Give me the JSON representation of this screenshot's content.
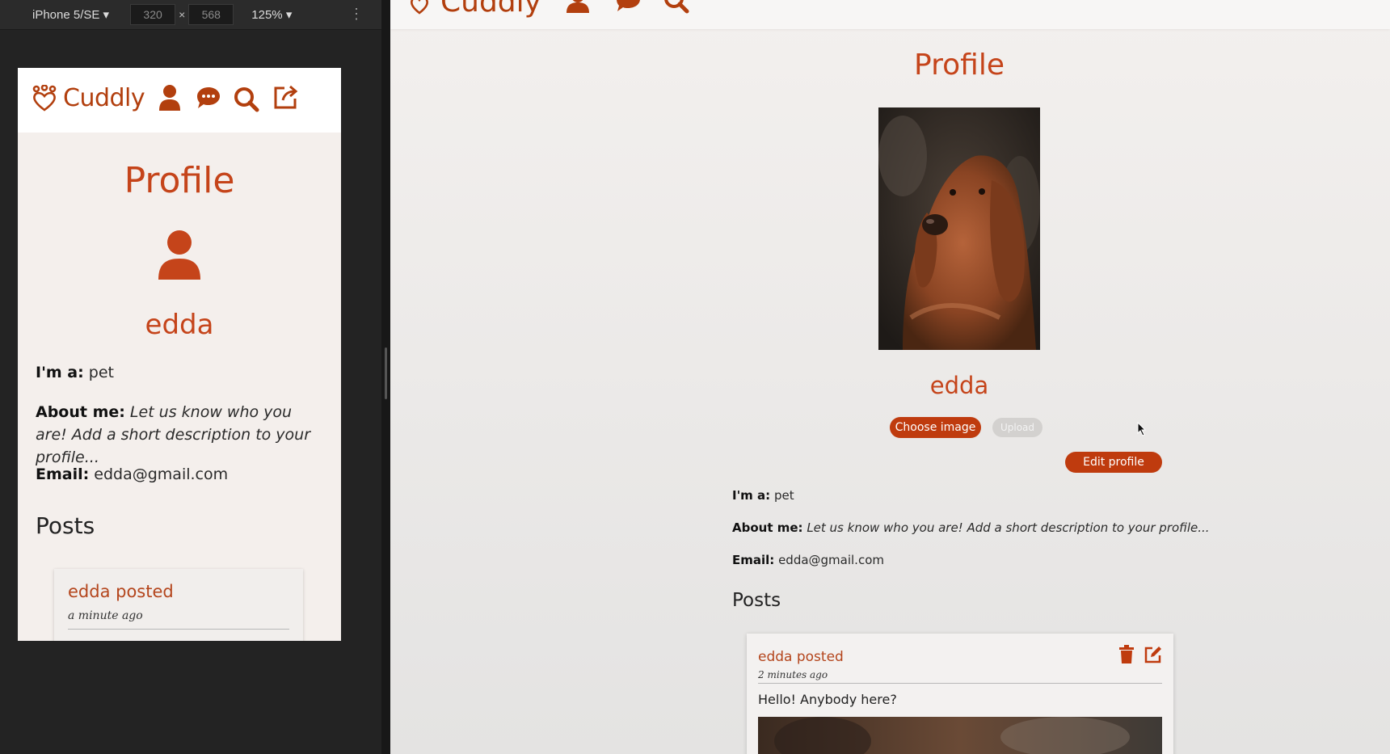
{
  "devtools": {
    "device": "iPhone 5/SE ▾",
    "width": "320",
    "times": "×",
    "height": "568",
    "zoom": "125% ▾",
    "more": "⋮"
  },
  "brand": {
    "name": "Cuddly",
    "accent": "#c5441a",
    "button": "#bf3b0e"
  },
  "mobile": {
    "title": "Profile",
    "username": "edda",
    "im_a_label": "I'm a:",
    "im_a_value": "pet",
    "about_label": "About me:",
    "about_value": "Let us know who you are! Add a short description to your profile...",
    "email_label": "Email:",
    "email_value": "edda@gmail.com",
    "posts_heading": "Posts",
    "post": {
      "author": "edda posted",
      "time": "a minute ago"
    }
  },
  "desktop": {
    "title": "Profile",
    "username": "edda",
    "choose_image": "Choose image",
    "upload": "Upload",
    "edit_profile": "Edit profile",
    "im_a_label": "I'm a:",
    "im_a_value": "pet",
    "about_label": "About me:",
    "about_value": "Let us know who you are! Add a short description to your profile...",
    "email_label": "Email:",
    "email_value": "edda@gmail.com",
    "posts_heading": "Posts",
    "post": {
      "author": "edda posted",
      "time": "2 minutes ago",
      "text": "Hello! Anybody here?"
    }
  },
  "icons": [
    "paw-heart-icon",
    "user-icon",
    "chat-bubble-icon",
    "search-icon",
    "logout-icon",
    "trash-icon",
    "edit-icon",
    "cursor-icon"
  ]
}
